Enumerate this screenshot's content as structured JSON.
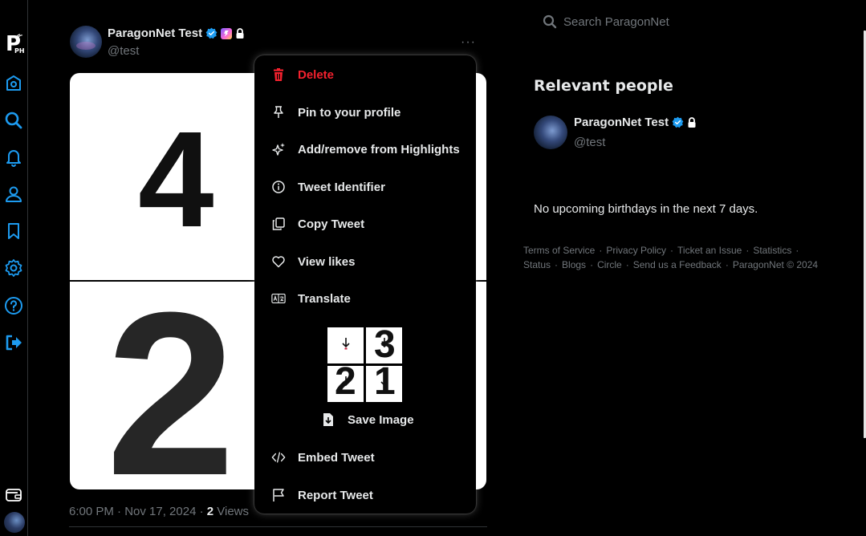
{
  "sidebar": {
    "logo_main": "P",
    "logo_sub": "PH"
  },
  "tweet": {
    "author_name": "ParagonNet Test",
    "author_handle": "@test",
    "more_label": "···",
    "image_digits": [
      "4",
      "2"
    ],
    "time": "6:00 PM · Nov 17, 2024 · ",
    "views_count": "2",
    "views_label": " Views"
  },
  "menu": {
    "items": [
      {
        "label": "Delete",
        "icon": "trash-icon"
      },
      {
        "label": "Pin to your profile",
        "icon": "pin-icon"
      },
      {
        "label": "Add/remove from Highlights",
        "icon": "sparkle-icon"
      },
      {
        "label": "Tweet Identifier",
        "icon": "info-icon"
      },
      {
        "label": "Copy Tweet",
        "icon": "copy-icon"
      },
      {
        "label": "View likes",
        "icon": "heart-icon"
      },
      {
        "label": "Translate",
        "icon": "translate-icon"
      },
      {
        "label": "Embed Tweet",
        "icon": "code-icon"
      },
      {
        "label": "Report Tweet",
        "icon": "flag-icon"
      }
    ],
    "save_image_label": "Save Image",
    "thumb_digits": [
      "",
      "3",
      "2",
      "1"
    ]
  },
  "search": {
    "placeholder": "Search ParagonNet"
  },
  "relevant_people": {
    "title": "Relevant people",
    "name": "ParagonNet Test",
    "handle": "@test"
  },
  "birthdays": {
    "text": "No upcoming birthdays in the next 7 days."
  },
  "footer": {
    "links": [
      "Terms of Service",
      "Privacy Policy",
      "Ticket an Issue",
      "Statistics",
      "Status",
      "Blogs",
      "Circle",
      "Send us a Feedback",
      "ParagonNet © 2024"
    ]
  },
  "colors": {
    "accent": "#1d9bf0",
    "danger": "#f4212e",
    "muted": "#71767b",
    "text": "#e7e9ea",
    "background": "#000000"
  }
}
